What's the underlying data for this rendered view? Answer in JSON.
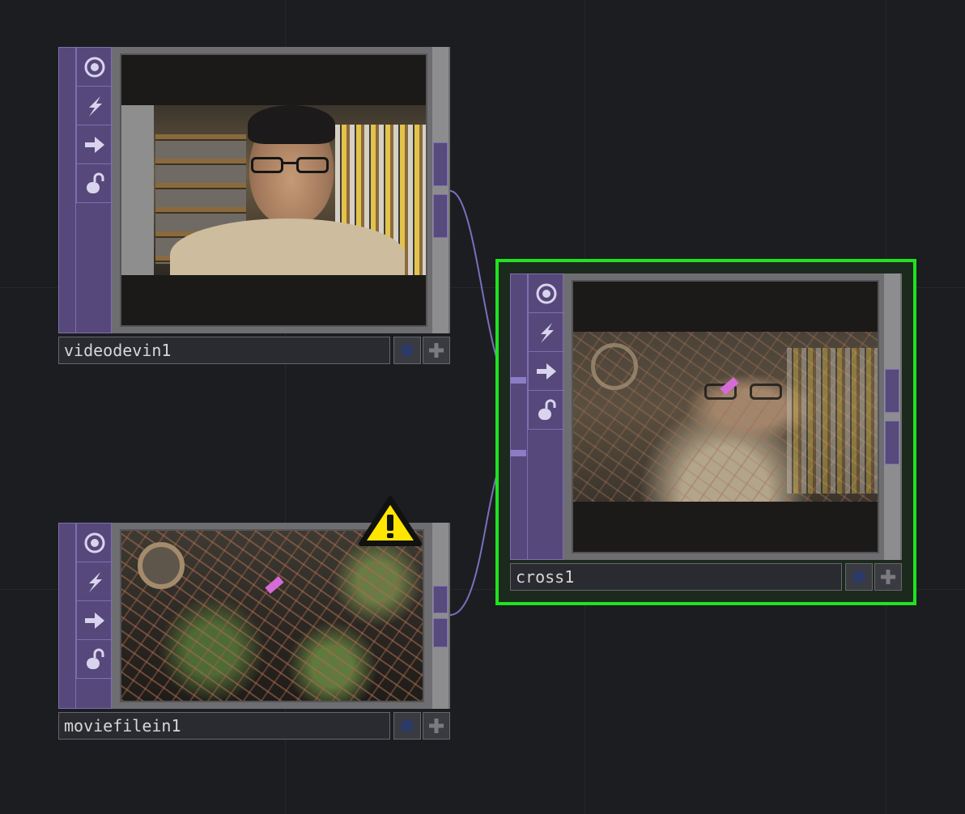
{
  "nodes": {
    "videodevin": {
      "name": "videodevin1"
    },
    "moviefilein": {
      "name": "moviefilein1",
      "warning": true
    },
    "cross": {
      "name": "cross1",
      "selected": true
    }
  },
  "icons": [
    "viewer-icon",
    "cook-icon",
    "export-icon",
    "lock-icon"
  ],
  "colors": {
    "background": "#1c1d21",
    "node_purple": "#56487a",
    "wire": "#7a6fbd",
    "selection": "#1fe31f",
    "warning": "#ffe600"
  }
}
